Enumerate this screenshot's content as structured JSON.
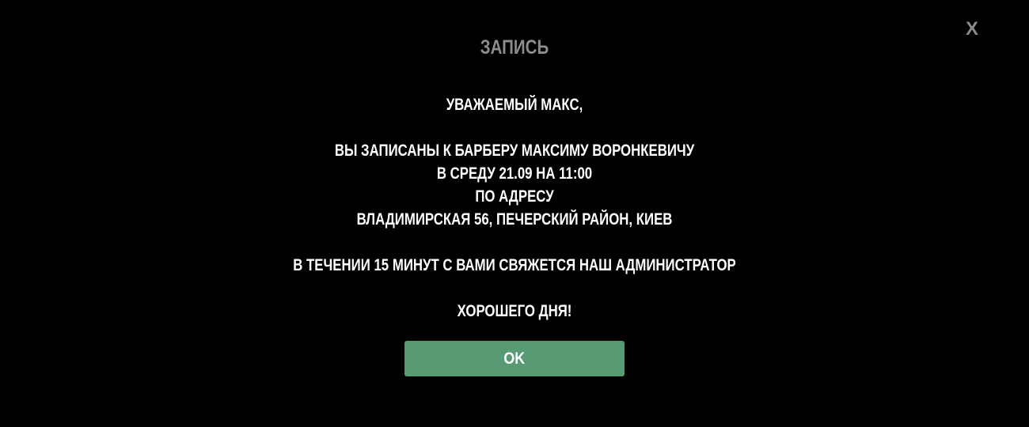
{
  "dialog": {
    "close_label": "X",
    "title": "ЗАПИСЬ",
    "lines": {
      "greeting": "УВАЖАЕМЫЙ МАКС,",
      "booking": "ВЫ ЗАПИСАНЫ К БАРБЕРУ МАКСИМУ ВОРОНКЕВИЧУ",
      "datetime": "В СРЕДУ 21.09 НА 11:00",
      "address_label": "ПО АДРЕСУ",
      "address": "ВЛАДИМИРСКАЯ 56, ПЕЧЕРСКИЙ РАЙОН, КИЕВ",
      "contact": "В ТЕЧЕНИИ 15 МИНУТ С ВАМИ СВЯЖЕТСЯ НАШ АДМИНИСТРАТОР",
      "farewell": "ХОРОШЕГО ДНЯ!"
    },
    "ok_label": "OK"
  },
  "colors": {
    "background": "#000000",
    "title": "#8c8c8c",
    "text": "#ffffff",
    "close": "#8a8a8a",
    "ok_button": "#589a74"
  }
}
